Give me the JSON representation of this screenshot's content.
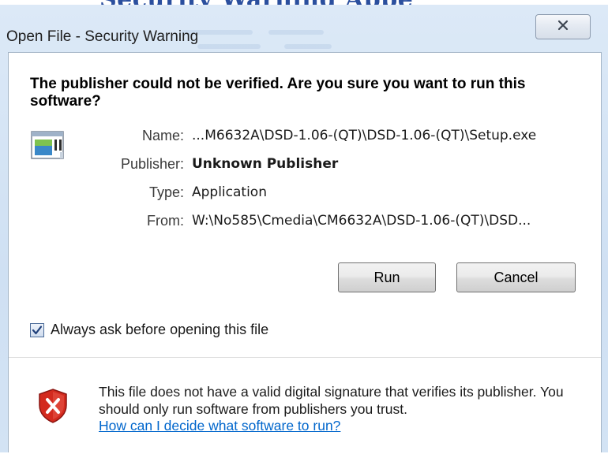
{
  "background": {
    "heading": "Security Warning Appe"
  },
  "window": {
    "title": "Open File - Security Warning",
    "close_icon": "close-x-icon"
  },
  "prompt": {
    "question": "The publisher could not be verified.  Are you sure you want to run this software?",
    "app_icon": "application-window-icon"
  },
  "details": {
    "name_label": "Name:",
    "name_value": "...M6632A\\DSD-1.06-(QT)\\DSD-1.06-(QT)\\Setup.exe",
    "publisher_label": "Publisher:",
    "publisher_value": "Unknown Publisher",
    "type_label": "Type:",
    "type_value": "Application",
    "from_label": "From:",
    "from_value": "W:\\No585\\Cmedia\\CM6632A\\DSD-1.06-(QT)\\DSD..."
  },
  "buttons": {
    "run_label": "Run",
    "cancel_label": "Cancel"
  },
  "checkbox": {
    "label": "Always ask before opening this file",
    "checked": true
  },
  "warning": {
    "icon": "shield-x-icon",
    "text": "This file does not have a valid digital signature that verifies its publisher.  You should only run software from publishers you trust.",
    "link": "How can I decide what software to run?"
  },
  "colors": {
    "frame": "#cfe0f3",
    "link": "#0066cc",
    "shield_red": "#d32a1e"
  }
}
